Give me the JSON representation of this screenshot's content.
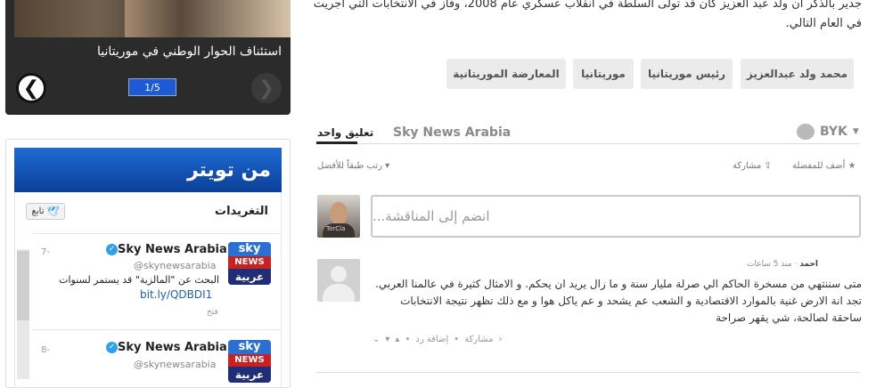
{
  "article": {
    "text_line1": "جدير بالذكر أن ولد عبد العزيز كان قد تولى السلطة في انقلاب عسكري عام 2008، وفاز في الانتخابات التي أجريت",
    "text_line2": "في العام التالي."
  },
  "slider": {
    "caption": "استئناف الحوار الوطني في موريتانيا",
    "counter": "1/5",
    "next_icon": "chevron-left-icon",
    "prev_icon": "chevron-right-icon"
  },
  "twitter": {
    "header_title": "من تويتر",
    "section_title": "التغريدات",
    "follow_label": "تابع",
    "tweets": [
      {
        "name": "Sky News Arabia",
        "handle": "@skynewsarabia",
        "text": "البحث عن \"المالزية\" قد يستمر لسنوات",
        "link": "bit.ly/QDBDI1",
        "time": "7-",
        "open": "فتح",
        "logo_top": "sky",
        "logo_mid": "NEWS",
        "logo_bottom": "عربية"
      },
      {
        "name": "Sky News Arabia",
        "handle": "@skynewsarabia",
        "time": "8-",
        "logo_top": "sky",
        "logo_mid": "NEWS",
        "logo_bottom": "عربية"
      }
    ]
  },
  "tags": [
    "محمد ولد عبدالعزيز",
    "رئيس موريتانيا",
    "موريتانيا",
    "المعارضة الموريتانية"
  ],
  "comments": {
    "tab_count": "تعليق واحد",
    "tab_site": "Sky News Arabia",
    "user": "BYK",
    "favorite_label": "أضف للمفضلة",
    "share_label": "مشاركة",
    "sort_label": "رتب طبقاً للأفضل",
    "composer_placeholder": "انضم إلى المناقشة...",
    "composer_avatar_text": "TorCla",
    "items": [
      {
        "author": "احمد",
        "time": "منذ 5 ساعات",
        "body": "متى سننتهي من مسخرة الحاكم الي صرلة مليار سنة و ما زال يريد ان يحكم. و الامثال كثيرة في عالمنا العربي. تجد انة الارض غنية بالموارد الاقتصادية و الشعب عم يشحد و عم ياكل هوا و مع ذلك تظهر نتيجة الانتخابات ساحقة لصالحة، شي يقهر صراحة",
        "share": "مشاركة",
        "reply": "إضافة رد"
      }
    ]
  },
  "colors": {
    "twitter_header": "#1e6ad3",
    "counter": "#1d5bd6",
    "tag_bg": "#ebebeb"
  }
}
